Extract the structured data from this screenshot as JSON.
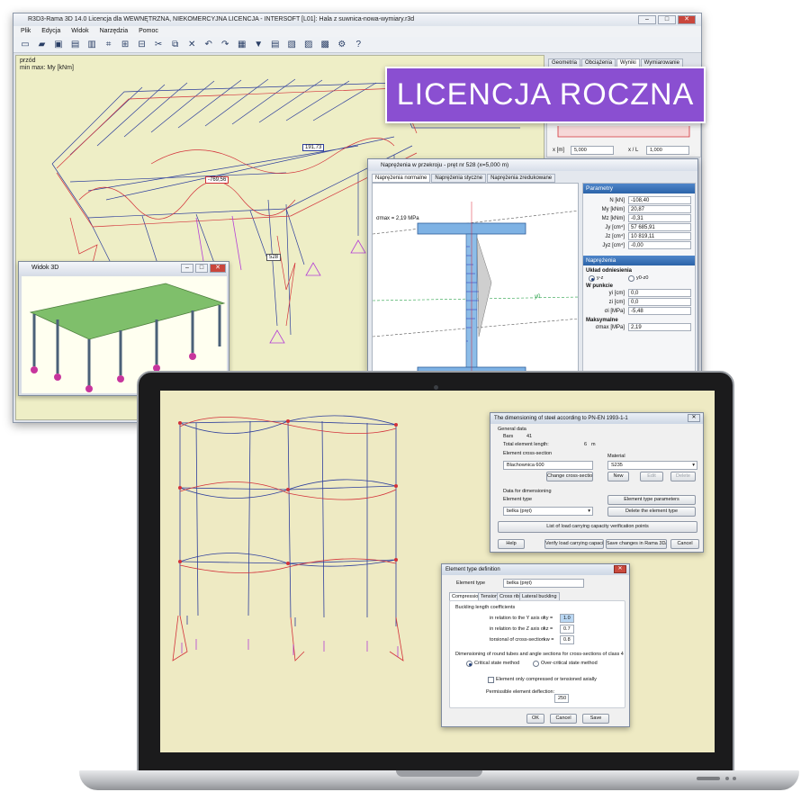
{
  "back_window": {
    "title": "R3D3-Rama 3D 14.0 Licencja dla WEWNĘTRZNA, NIEKOMERCYJNA LICENCJA - INTERSOFT [L01]: Hala z suwnica-nowa-wymiary.r3d",
    "menu": [
      "Plik",
      "Edycja",
      "Widok",
      "Narzędzia",
      "Pomoc"
    ],
    "view_label_1": "przód",
    "view_label_2": "min max: My [kNm]",
    "value_label_1": "191,73",
    "value_label_2": "-769,56",
    "value_label_3": "528",
    "right_tabs": [
      "Geometria",
      "Obciążenia",
      "Wyniki",
      "Wymiarowanie"
    ],
    "x_m_label": "x [m]",
    "x_m_value": "5,000",
    "x_l_label": "x / L",
    "x_l_value": "1,000"
  },
  "badge": {
    "text": "LICENCJA ROCZNA"
  },
  "window_3d": {
    "title": "Widok 3D"
  },
  "stress_window": {
    "title": "Naprężenia w przekroju - pręt nr 528 (x=5,000 m)",
    "tabs": [
      "Naprężenia normalne",
      "Naprężenia styczne",
      "Naprężenia zredukowane"
    ],
    "sigma_label": "σmax = 2,19 MPa",
    "axis_label": "y0",
    "params_header": "Parametry",
    "params": [
      {
        "k": "N [kN]",
        "v": "-108,40"
      },
      {
        "k": "My [kNm]",
        "v": "20,87"
      },
      {
        "k": "Mz [kNm]",
        "v": "-0,31"
      },
      {
        "k": "Jy [cm⁴]",
        "v": "57 685,91"
      },
      {
        "k": "Jz [cm⁴]",
        "v": "10 819,11"
      },
      {
        "k": "Jyz [cm⁴]",
        "v": "-0,00"
      }
    ],
    "stress_header": "Naprężenia",
    "ref_system_label": "Układ odniesienia",
    "ref_opt1": "y-z",
    "ref_opt2": "y0-z0",
    "point_label": "W punkcie",
    "point_params": [
      {
        "k": "yi [cm]",
        "v": "0,0"
      },
      {
        "k": "zi [cm]",
        "v": "0,0"
      },
      {
        "k": "σi [MPa]",
        "v": "-5,48"
      }
    ],
    "max_label": "Maksymalne",
    "max_param": {
      "k": "σmax [MPa]",
      "v": "2,19"
    }
  },
  "dim_dialog": {
    "title": "The dimensioning of steel according to PN-EN 1993-1-1",
    "general_data": "General data",
    "bars_label": "Bars",
    "bars_value": "41",
    "length_label": "Total element length:",
    "length_value": "6",
    "length_unit": "m",
    "section_label": "Element cross-section",
    "section_value": "Blachownica 600",
    "change_section_btn": "Change cross-section",
    "material_label": "Material",
    "material_value": "S235",
    "new_btn": "New",
    "edit_btn": "Edit",
    "delete_btn": "Delete",
    "data_for_dim": "Data for dimensioning",
    "element_type_label": "Element type",
    "element_type_value": "belka (pręt)",
    "type_params_btn": "Element type parameters",
    "delete_type_btn": "Delete the element type",
    "list_btn": "List of load carrying capacity verification points",
    "help_btn": "Help",
    "verify_btn": "Verify load carrying capacity",
    "save_btn": "Save changes in Rama 3D/2D",
    "cancel_btn": "Cancel"
  },
  "type_dialog": {
    "title": "Element type definition",
    "element_type_label": "Element type",
    "element_type_value": "belka (pręt)",
    "tabs": [
      "Compression",
      "Tension",
      "Cross ribs",
      "Lateral buckling"
    ],
    "buckling_header": "Buckling length coefficients",
    "rows": [
      {
        "label": "in relation to the Y axis of",
        "sym": "ky =",
        "val": "1.0"
      },
      {
        "label": "in relation to the Z axis of",
        "sym": "kz =",
        "val": "0.7"
      },
      {
        "label": "torsional of cross-section",
        "sym": "kw =",
        "val": "0.8"
      }
    ],
    "class4_header": "Dimensioning of round tubes and angle sections for cross-sections of class 4",
    "critical_opt": "Critical state method",
    "overcritical_opt": "Over-critical state method",
    "axial_check": "Element only compressed or tensioned axially",
    "deflection_label": "Permissible element deflection:",
    "deflection_value": "250",
    "ok_btn": "OK",
    "cancel_btn": "Cancel",
    "save_btn": "Save"
  },
  "colors": {
    "badge": "#8a4fd1",
    "view_bg": "#eeeec6",
    "frame_blue": "#2d3e9c",
    "frame_red": "#d3323a",
    "support_magenta": "#b43fd6"
  }
}
